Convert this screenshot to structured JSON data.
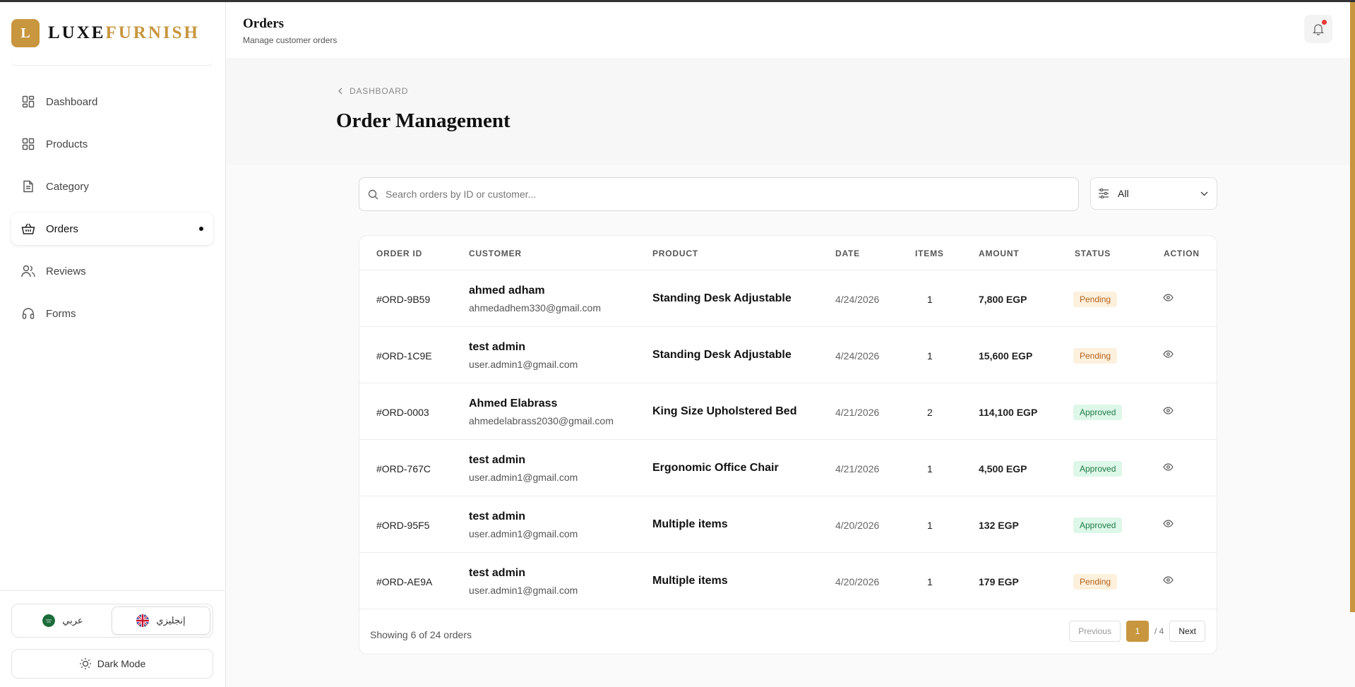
{
  "brand": {
    "mark": "L",
    "name_a": "LUXE",
    "name_b": "FURNISH"
  },
  "nav": [
    {
      "label": "Dashboard",
      "icon": "dashboard-icon"
    },
    {
      "label": "Products",
      "icon": "grid-icon"
    },
    {
      "label": "Category",
      "icon": "document-icon"
    },
    {
      "label": "Orders",
      "icon": "basket-icon",
      "active": true
    },
    {
      "label": "Reviews",
      "icon": "users-icon"
    },
    {
      "label": "Forms",
      "icon": "headset-icon"
    }
  ],
  "language": {
    "arabic": "عربي",
    "english": "إنجليزي"
  },
  "dark_mode_label": "Dark Mode",
  "header": {
    "title": "Orders",
    "subtitle": "Manage customer orders"
  },
  "breadcrumb": "DASHBOARD",
  "page_title": "Order Management",
  "search": {
    "placeholder": "Search orders by ID or customer..."
  },
  "filter": {
    "value": "All"
  },
  "table": {
    "headers": [
      "ORDER ID",
      "CUSTOMER",
      "PRODUCT",
      "DATE",
      "ITEMS",
      "AMOUNT",
      "STATUS",
      "ACTION"
    ],
    "rows": [
      {
        "id": "#ORD-9B59",
        "name": "ahmed adham",
        "email": "ahmedadhem330@gmail.com",
        "product": "Standing Desk Adjustable",
        "date": "4/24/2026",
        "items": "1",
        "amount": "7,800 EGP",
        "status": "Pending"
      },
      {
        "id": "#ORD-1C9E",
        "name": "test admin",
        "email": "user.admin1@gmail.com",
        "product": "Standing Desk Adjustable",
        "date": "4/24/2026",
        "items": "1",
        "amount": "15,600 EGP",
        "status": "Pending"
      },
      {
        "id": "#ORD-0003",
        "name": "Ahmed Elabrass",
        "email": "ahmedelabrass2030@gmail.com",
        "product": "King Size Upholstered Bed",
        "date": "4/21/2026",
        "items": "2",
        "amount": "114,100 EGP",
        "status": "Approved"
      },
      {
        "id": "#ORD-767C",
        "name": "test admin",
        "email": "user.admin1@gmail.com",
        "product": "Ergonomic Office Chair",
        "date": "4/21/2026",
        "items": "1",
        "amount": "4,500 EGP",
        "status": "Approved"
      },
      {
        "id": "#ORD-95F5",
        "name": "test admin",
        "email": "user.admin1@gmail.com",
        "product": "Multiple items",
        "date": "4/20/2026",
        "items": "1",
        "amount": "132 EGP",
        "status": "Approved"
      },
      {
        "id": "#ORD-AE9A",
        "name": "test admin",
        "email": "user.admin1@gmail.com",
        "product": "Multiple items",
        "date": "4/20/2026",
        "items": "1",
        "amount": "179 EGP",
        "status": "Pending"
      }
    ]
  },
  "footer": {
    "showing": "Showing 6 of 24 orders",
    "previous": "Previous",
    "current_page": "1",
    "total_pages": "/ 4",
    "next": "Next"
  },
  "colors": {
    "accent": "#c8963e",
    "pending_bg": "#fdf0dc",
    "approved_bg": "#ddf7e8"
  }
}
